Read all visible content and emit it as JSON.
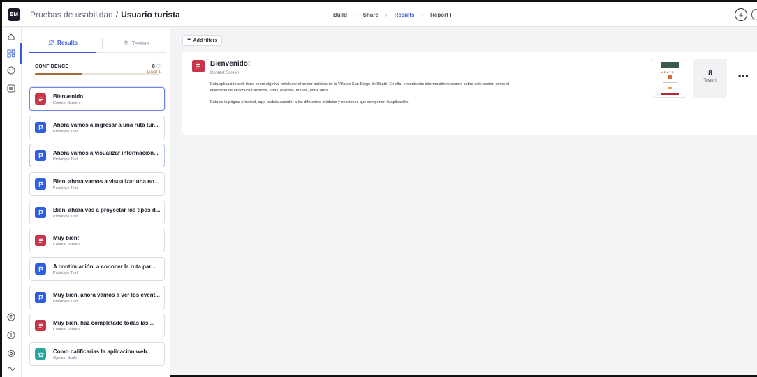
{
  "app": {
    "logo_text": "EM",
    "breadcrumb_project": "Pruebas de usabilidad",
    "breadcrumb_sep": "/",
    "breadcrumb_current": "Usuario turista"
  },
  "steps": [
    {
      "label": "Build"
    },
    {
      "label": "Share"
    },
    {
      "label": "Results"
    },
    {
      "label": "Report"
    }
  ],
  "sidebar": {
    "tab_results": "Results",
    "tab_testers": "Testers",
    "confidence_label": "CONFIDENCE",
    "confidence_count": "8",
    "confidence_level": "Level 1",
    "confidence_progress": 0.38,
    "cards": [
      {
        "title": "Bienvenido!",
        "subtitle": "Context Screen",
        "type": "context"
      },
      {
        "title": "Ahora vamos a ingresar a una ruta tur...",
        "subtitle": "Prototype Test",
        "type": "prototype"
      },
      {
        "title": "Ahora vamos a visualizar información...",
        "subtitle": "Prototype Test",
        "type": "prototype"
      },
      {
        "title": "Bien, ahora vamos a visualizar una no...",
        "subtitle": "Prototype Test",
        "type": "prototype"
      },
      {
        "title": "Bien, ahora vas a proyectar los tipos d...",
        "subtitle": "Prototype Test",
        "type": "prototype"
      },
      {
        "title": "Muy bien!",
        "subtitle": "Context Screen",
        "type": "context"
      },
      {
        "title": "A continuación, a conocer la ruta par...",
        "subtitle": "Prototype Test",
        "type": "prototype"
      },
      {
        "title": "Muy bien, ahora vamos a ver los event...",
        "subtitle": "Prototype Test",
        "type": "prototype"
      },
      {
        "title": "Muy bien, haz completado todas las ...",
        "subtitle": "Context Screen",
        "type": "context"
      },
      {
        "title": "Como calificarias la aplicacion web.",
        "subtitle": "Opinion Scale",
        "type": "opinion"
      }
    ]
  },
  "main": {
    "add_filters": "Add filters",
    "panel_title": "Bienvenido!",
    "panel_subtitle": "Context Screen",
    "panel_desc": "Esta aplicación web tiene como objetivo fortalecer el sector turístico de la Villa de San Diego de Ubaté. En ella, encontrarás información relevante sobre este sector, como el inventario de atractivos turísticos, rutas, eventos, mapas, entre otros.",
    "panel_desc2": "Esta es la página principal, aquí podrás acceder a los diferentes módulos y secciones que componen la aplicación.",
    "thumb_text": "UBATE",
    "testers_count": "8",
    "testers_label": "Testers",
    "more": "•••"
  },
  "colors": {
    "accent": "#3a5bd9",
    "context": "#c8344a",
    "prototype": "#2f5ee0",
    "opinion": "#2aa59a",
    "confidence": "#a06a3a"
  }
}
